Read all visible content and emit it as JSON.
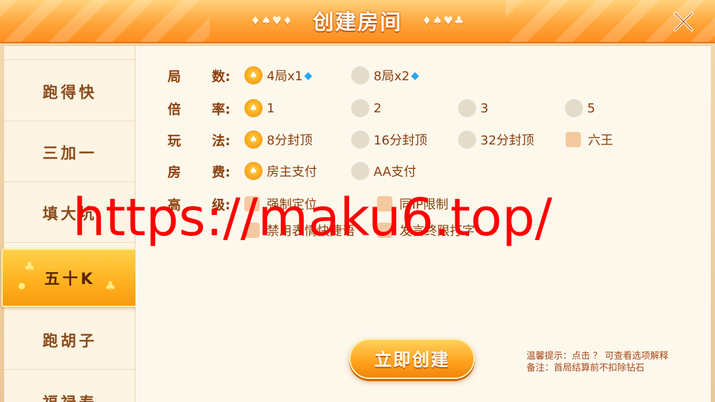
{
  "header": {
    "title": "创建房间",
    "suits_left": "♦♠♥♦",
    "suits_right": "♦♠♥♣",
    "close_icon": "close-x-icon"
  },
  "sidebar": {
    "items": [
      {
        "label": "跑得快",
        "active": false
      },
      {
        "label": "三加一",
        "active": false
      },
      {
        "label": "填大坑",
        "active": false
      },
      {
        "label": "五十K",
        "active": true
      },
      {
        "label": "跑胡子",
        "active": false
      },
      {
        "label": "福禄寿",
        "active": false
      }
    ]
  },
  "settings": {
    "rounds": {
      "label_a": "局",
      "label_b": "数:",
      "options": [
        {
          "text": "4局x1",
          "selected": true,
          "icon": "diamond-gem-icon"
        },
        {
          "text": "8局x2",
          "selected": false,
          "icon": "diamond-gem-icon"
        }
      ]
    },
    "multiplier": {
      "label_a": "倍",
      "label_b": "率:",
      "options": [
        {
          "text": "1",
          "selected": true
        },
        {
          "text": "2",
          "selected": false
        },
        {
          "text": "3",
          "selected": false
        },
        {
          "text": "5",
          "selected": false
        }
      ]
    },
    "play": {
      "label_a": "玩",
      "label_b": "法:",
      "options": [
        {
          "text": "8分封顶",
          "selected": true
        },
        {
          "text": "16分封顶",
          "selected": false
        },
        {
          "text": "32分封顶",
          "selected": false
        },
        {
          "text": "六王",
          "selected": false,
          "type": "checkbox"
        }
      ]
    },
    "fee": {
      "label_a": "房",
      "label_b": "费:",
      "options": [
        {
          "text": "房主支付",
          "selected": true
        },
        {
          "text": "AA支付",
          "selected": false
        }
      ]
    },
    "advanced": {
      "label_a": "高",
      "label_b": "级:",
      "options": [
        {
          "text": "强制定位",
          "checked": false
        },
        {
          "text": "同IP限制",
          "checked": false
        },
        {
          "text": "禁用表情快捷语",
          "checked": false
        },
        {
          "text": "发言终限打字",
          "checked": false
        }
      ]
    }
  },
  "create_button": "立即创建",
  "tips": {
    "line1": "温馨提示：点击 ？  可查看选项解释",
    "line2": "备注：首局结算前不扣除钻石"
  },
  "watermark": "https://maku6.top/",
  "colors": {
    "header_orange": "#ffa53a",
    "label_brown": "#8b3f0c",
    "active_yellow": "#ffb11d",
    "watermark_red": "#ff0000"
  }
}
